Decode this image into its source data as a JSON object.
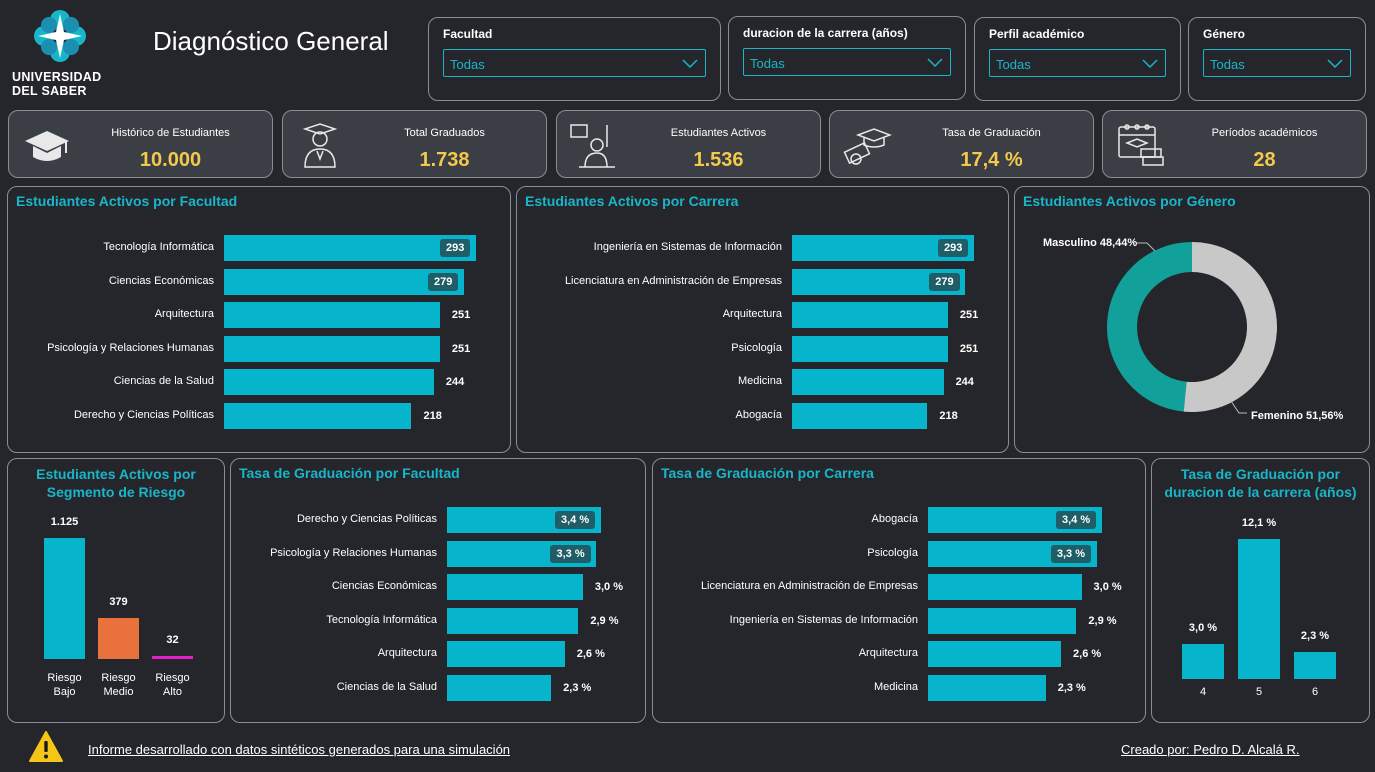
{
  "header": {
    "logo_line1": "UNIVERSIDAD",
    "logo_line2": "DEL SABER",
    "title": "Diagnóstico General"
  },
  "filters": [
    {
      "label": "Facultad",
      "value": "Todas"
    },
    {
      "label": "duracion de la carrera (años)",
      "value": "Todas"
    },
    {
      "label": "Perfil académico",
      "value": "Todas"
    },
    {
      "label": "Género",
      "value": "Todas"
    }
  ],
  "kpis": [
    {
      "label": "Histórico de Estudiantes",
      "value": "10.000",
      "icon": "graduation-cap-icon"
    },
    {
      "label": "Total Graduados",
      "value": "1.738",
      "icon": "graduate-person-icon"
    },
    {
      "label": "Estudiantes Activos",
      "value": "1.536",
      "icon": "student-raising-hand-icon"
    },
    {
      "label": "Tasa de Graduación",
      "value": "17,4 %",
      "icon": "diploma-cap-icon"
    },
    {
      "label": "Períodos académicos",
      "value": "28",
      "icon": "calendar-icon"
    }
  ],
  "colors": {
    "accent": "#19b6c9",
    "bar": "#06b4cc",
    "kpi_value": "#f2c94c",
    "risk_medium": "#e8713c",
    "risk_high": "#e020c8",
    "donut_male": "#12a19a",
    "donut_female": "#c8c8c8"
  },
  "chart_data": [
    {
      "id": "activos_facultad",
      "type": "bar",
      "orientation": "horizontal",
      "title": "Estudiantes Activos por Facultad",
      "categories": [
        "Tecnología Informática",
        "Ciencias Económicas",
        "Arquitectura",
        "Psicología y Relaciones Humanas",
        "Ciencias de la Salud",
        "Derecho y Ciencias Políticas"
      ],
      "values": [
        293,
        279,
        251,
        251,
        244,
        218
      ],
      "labels": [
        "293",
        "279",
        "251",
        "251",
        "244",
        "218"
      ],
      "max": 293
    },
    {
      "id": "activos_carrera",
      "type": "bar",
      "orientation": "horizontal",
      "title": "Estudiantes Activos por Carrera",
      "categories": [
        "Ingeniería en Sistemas de Información",
        "Licenciatura en Administración de Empresas",
        "Arquitectura",
        "Psicología",
        "Medicina",
        "Abogacía"
      ],
      "values": [
        293,
        279,
        251,
        251,
        244,
        218
      ],
      "labels": [
        "293",
        "279",
        "251",
        "251",
        "244",
        "218"
      ],
      "max": 293
    },
    {
      "id": "activos_genero",
      "type": "pie",
      "title": "Estudiantes Activos por Género",
      "categories": [
        "Masculino",
        "Femenino"
      ],
      "values": [
        48.44,
        51.56
      ],
      "labels": [
        "Masculino 48,44%",
        "Femenino 51,56%"
      ]
    },
    {
      "id": "riesgo",
      "type": "bar",
      "orientation": "vertical",
      "title": "Estudiantes Activos por Segmento de Riesgo",
      "categories": [
        "Riesgo Bajo",
        "Riesgo Medio",
        "Riesgo Alto"
      ],
      "values": [
        1125,
        379,
        32
      ],
      "labels": [
        "1.125",
        "379",
        "32"
      ]
    },
    {
      "id": "tasa_facultad",
      "type": "bar",
      "orientation": "horizontal",
      "title": "Tasa de Graduación por Facultad",
      "categories": [
        "Derecho y Ciencias Políticas",
        "Psicología y Relaciones Humanas",
        "Ciencias Económicas",
        "Tecnología Informática",
        "Arquitectura",
        "Ciencias de la Salud"
      ],
      "values": [
        3.4,
        3.3,
        3.0,
        2.9,
        2.6,
        2.3
      ],
      "labels": [
        "3,4 %",
        "3,3 %",
        "3,0 %",
        "2,9 %",
        "2,6 %",
        "2,3 %"
      ],
      "max": 3.4
    },
    {
      "id": "tasa_carrera",
      "type": "bar",
      "orientation": "horizontal",
      "title": "Tasa de Graduación por Carrera",
      "categories": [
        "Abogacía",
        "Psicología",
        "Licenciatura en Administración de Empresas",
        "Ingeniería en Sistemas de Información",
        "Arquitectura",
        "Medicina"
      ],
      "values": [
        3.4,
        3.3,
        3.0,
        2.9,
        2.6,
        2.3
      ],
      "labels": [
        "3,4 %",
        "3,3 %",
        "3,0 %",
        "2,9 %",
        "2,6 %",
        "2,3 %"
      ],
      "max": 3.4
    },
    {
      "id": "tasa_duracion",
      "type": "bar",
      "orientation": "vertical",
      "title": "Tasa de Graduación por duracion de la carrera (años)",
      "categories": [
        "4",
        "5",
        "6"
      ],
      "values": [
        3.0,
        12.1,
        2.3
      ],
      "labels": [
        "3,0 %",
        "12,1 %",
        "2,3 %"
      ]
    }
  ],
  "footer": {
    "disclaimer": "Informe desarrollado con datos sintéticos generados para una simulación",
    "credit": "Creado por: Pedro D. Alcalá R."
  }
}
